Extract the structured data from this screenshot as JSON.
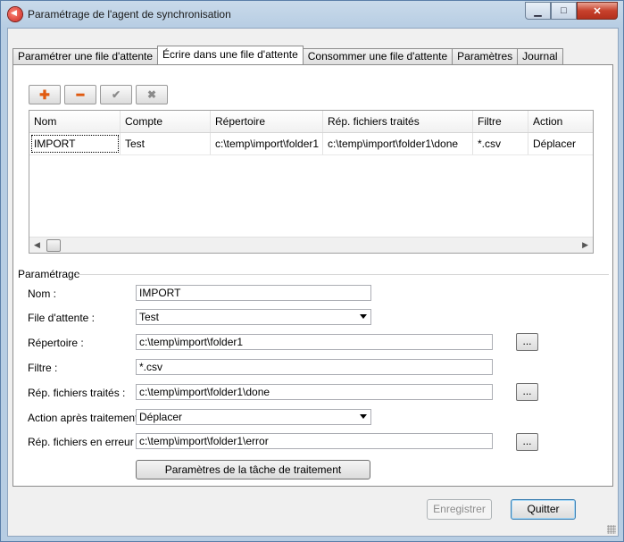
{
  "window": {
    "title": "Paramétrage de l'agent de synchronisation",
    "minimize_glyph": "▁",
    "maximize_glyph": "□",
    "close_glyph": "✕"
  },
  "tabs": [
    {
      "label": "Paramétrer une file d'attente",
      "active": false
    },
    {
      "label": "Écrire dans une file d'attente",
      "active": true
    },
    {
      "label": "Consommer une file d'attente",
      "active": false
    },
    {
      "label": "Paramètres",
      "active": false
    },
    {
      "label": "Journal",
      "active": false
    }
  ],
  "toolbar": {
    "add_glyph": "✚",
    "remove_glyph": "━",
    "validate_glyph": "✔",
    "cancel_glyph": "✖"
  },
  "grid": {
    "columns": [
      "Nom",
      "Compte",
      "Répertoire",
      "Rép. fichiers traités",
      "Filtre",
      "Action"
    ],
    "rows": [
      [
        "IMPORT",
        "Test",
        "c:\\temp\\import\\folder1",
        "c:\\temp\\import\\folder1\\done",
        "*.csv",
        "Déplacer"
      ]
    ],
    "scroll_left_glyph": "◀",
    "scroll_right_glyph": "▶"
  },
  "form": {
    "group_label": "Paramétrage",
    "name_label": "Nom :",
    "name_value": "IMPORT",
    "queue_label": "File d'attente :",
    "queue_value": "Test",
    "directory_label": "Répertoire :",
    "directory_value": "c:\\temp\\import\\folder1",
    "filter_label": "Filtre :",
    "filter_value": "*.csv",
    "processed_label": "Rép. fichiers traités :",
    "processed_value": "c:\\temp\\import\\folder1\\done",
    "action_label": "Action après traitement :",
    "action_value": "Déplacer",
    "error_label": "Rép. fichiers en erreur :",
    "error_value": "c:\\temp\\import\\folder1\\error",
    "browse_label": "...",
    "process_task_button": "Paramètres de la tâche de traitement"
  },
  "footer": {
    "save_button": "Enregistrer",
    "quit_button": "Quitter"
  }
}
